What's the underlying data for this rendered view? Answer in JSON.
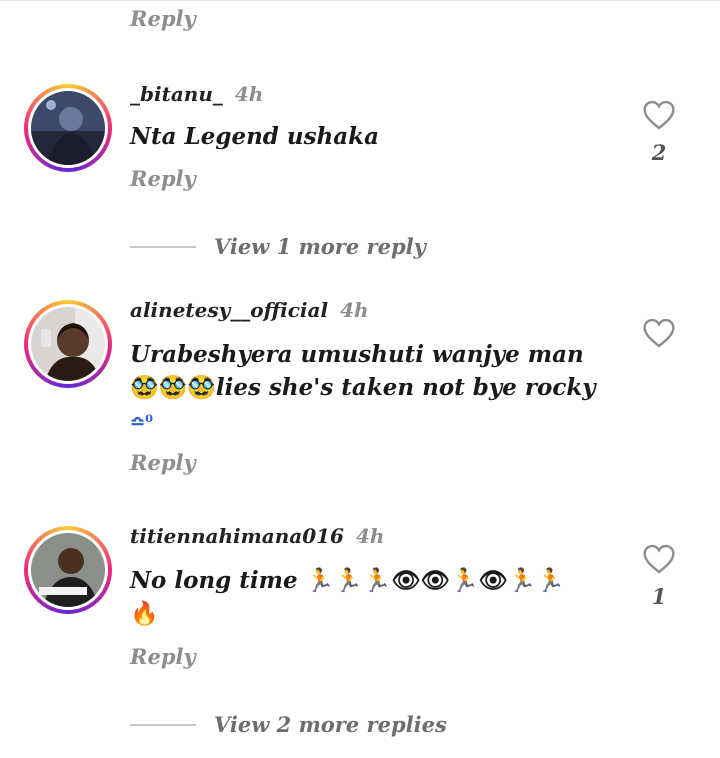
{
  "top": {
    "reply_label": "Reply"
  },
  "comments": [
    {
      "username": "_bitanu_",
      "time": "4h",
      "text": "Nta Legend ushaka",
      "reply_label": "Reply",
      "likes": "2",
      "view_more": "View 1 more reply"
    },
    {
      "username": "alinetesy__official",
      "time": "4h",
      "text_main": "Urabeshyera umushuti wanjye man",
      "text_line2": "lies she's taken not bye rocky",
      "reply_label": "Reply",
      "likes": ""
    },
    {
      "username": "titiennahimana016",
      "time": "4h",
      "text": "No long time",
      "reply_label": "Reply",
      "likes": "1",
      "view_more": "View 2 more replies"
    }
  ],
  "icons": {
    "heart": "heart-outline-icon",
    "runner": "running-person-icon",
    "eye": "eye-icon",
    "fire": "fire-icon",
    "disguise": "disguised-face-icon",
    "sweat": "sweat-face-icon"
  },
  "colors": {
    "ring": "#ee2a7b",
    "runner": "#1b2fd0",
    "muted": "#8e8e8e"
  }
}
